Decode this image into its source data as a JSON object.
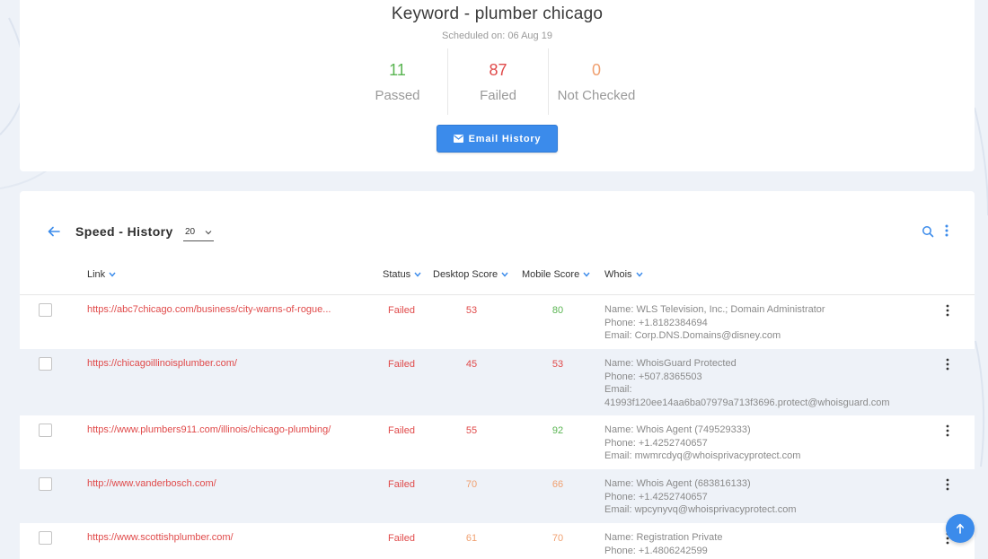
{
  "colors": {
    "accent": "#3b8beb",
    "passed": "#5ab552",
    "failed": "#e04a4a",
    "warning": "#f0a070"
  },
  "summary": {
    "title": "Keyword - plumber chicago",
    "scheduled": "Scheduled on: 06 Aug 19",
    "stats": [
      {
        "value": "11",
        "label": "Passed",
        "color": "#5ab552"
      },
      {
        "value": "87",
        "label": "Failed",
        "color": "#e04a4a"
      },
      {
        "value": "0",
        "label": "Not Checked",
        "color": "#f0a070"
      }
    ],
    "email_button": {
      "label": "Email History",
      "icon": "envelope-icon"
    }
  },
  "history": {
    "title": "Speed - History",
    "per_page": "20",
    "columns": {
      "link": "Link",
      "status": "Status",
      "desktop": "Desktop Score",
      "mobile": "Mobile Score",
      "whois": "Whois"
    },
    "rows": [
      {
        "link": "https://abc7chicago.com/business/city-warns-of-rogue...",
        "status": "Failed",
        "desktop": "53",
        "desktop_color": "#e04a4a",
        "mobile": "80",
        "mobile_color": "#5ab552",
        "whois": [
          "Name: WLS Television, Inc.; Domain Administrator",
          "Phone: +1.8182384694",
          "Email: Corp.DNS.Domains@disney.com"
        ]
      },
      {
        "link": "https://chicagoillinoisplumber.com/",
        "status": "Failed",
        "desktop": "45",
        "desktop_color": "#e04a4a",
        "mobile": "53",
        "mobile_color": "#e04a4a",
        "whois": [
          "Name: WhoisGuard Protected",
          "Phone: +507.8365503",
          "Email:",
          "41993f120ee14aa6ba07979a713f3696.protect@whoisguard.com"
        ]
      },
      {
        "link": "https://www.plumbers911.com/illinois/chicago-plumbing/",
        "status": "Failed",
        "desktop": "55",
        "desktop_color": "#e04a4a",
        "mobile": "92",
        "mobile_color": "#5ab552",
        "whois": [
          "Name: Whois Agent (749529333)",
          "Phone: +1.4252740657",
          "Email: mwmrcdyq@whoisprivacyprotect.com"
        ]
      },
      {
        "link": "http://www.vanderbosch.com/",
        "status": "Failed",
        "desktop": "70",
        "desktop_color": "#f0a070",
        "mobile": "66",
        "mobile_color": "#f0a070",
        "whois": [
          "Name: Whois Agent (683816133)",
          "Phone: +1.4252740657",
          "Email: wpcynyvq@whoisprivacyprotect.com"
        ]
      },
      {
        "link": "https://www.scottishplumber.com/",
        "status": "Failed",
        "desktop": "61",
        "desktop_color": "#f0a070",
        "mobile": "70",
        "mobile_color": "#f0a070",
        "whois": [
          "Name: Registration Private",
          "Phone: +1.4806242599"
        ]
      }
    ]
  }
}
